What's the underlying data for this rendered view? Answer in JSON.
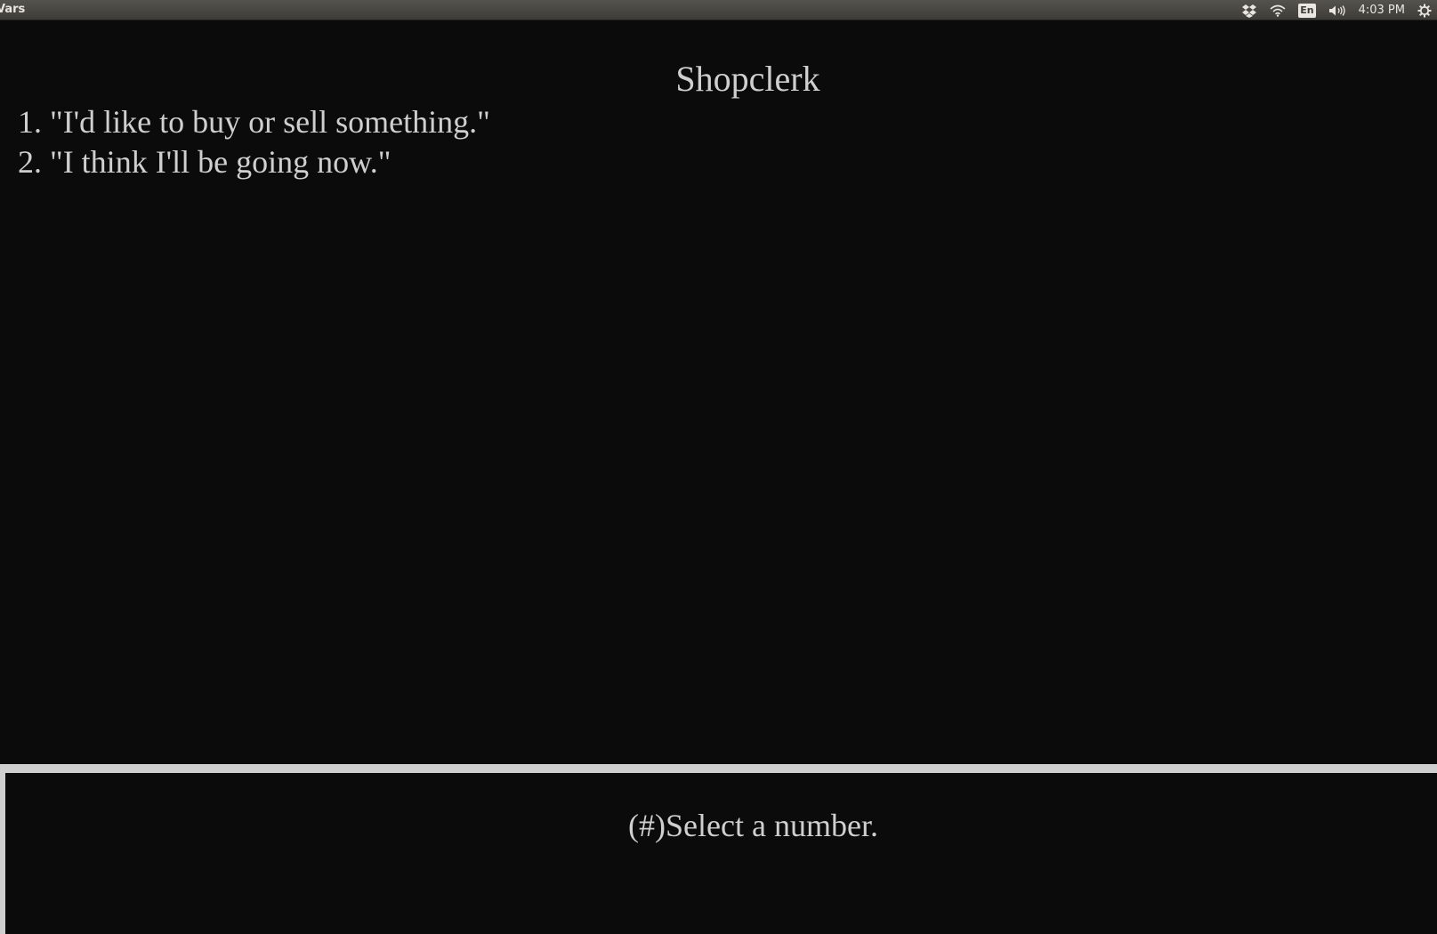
{
  "topbar": {
    "app_title": "Vars",
    "tray": {
      "dropbox_icon": "dropbox-icon",
      "wifi_icon": "wifi-icon",
      "keyboard_layout": "En",
      "volume_icon": "volume-icon",
      "clock": "4:03 PM",
      "settings_icon": "gear-icon"
    }
  },
  "dialog": {
    "speaker": "Shopclerk",
    "options": [
      {
        "text": "1. \"I'd like to buy or sell something.\""
      },
      {
        "text": "2. \"I think I'll be going now.\""
      }
    ]
  },
  "prompt": {
    "text": "(#)Select a number."
  },
  "colors": {
    "background": "#0b0b0b",
    "text": "#cfcfcf",
    "border": "#cfcfcf",
    "topbar": "#4a4944"
  }
}
